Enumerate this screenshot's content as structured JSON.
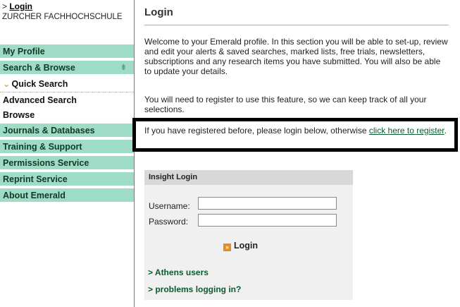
{
  "breadcrumb": {
    "prefix": "> ",
    "link": "Login"
  },
  "institution": "ZURCHER FACHHOCHSCHULE",
  "sidebar": {
    "items": [
      {
        "label": "My Profile"
      },
      {
        "label": "Search & Browse",
        "icon": "arrow-down-icon"
      },
      {
        "label": "Quick Search",
        "icon": "chevron-icon"
      },
      {
        "label": "Advanced Search"
      },
      {
        "label": "Browse"
      },
      {
        "label": "Journals & Databases"
      },
      {
        "label": "Training & Support"
      },
      {
        "label": "Permissions Service"
      },
      {
        "label": "Reprint Service"
      },
      {
        "label": "About Emerald"
      }
    ],
    "arrow_glyph": "⇟",
    "chevron_glyph": "⌄"
  },
  "main": {
    "title": "Login",
    "intro": "Welcome to your Emerald profile. In this section you will be able to set-up, review and edit your alerts & saved searches, marked lists, free trials, newsletters, subscriptions and any research items you have submitted. You will also be able to update your details.",
    "register_note": "You will need to register to use this feature, so we can keep track of all your selections.",
    "callout_text": "If you have registered before, please login below, otherwise ",
    "callout_link": "click here to register",
    "callout_end": "."
  },
  "login_box": {
    "header": "Insight Login",
    "username_label": "Username:",
    "password_label": "Password:",
    "username_value": "",
    "password_value": "",
    "login_label": "Login",
    "login_icon_glyph": "»",
    "athens_link": "> Athens users",
    "problems_link": "> problems logging in?"
  },
  "colors": {
    "nav_bg": "#9fdcc8",
    "accent": "#e88a1f",
    "link": "#0c5b2f"
  }
}
